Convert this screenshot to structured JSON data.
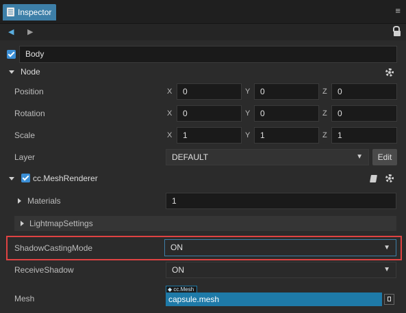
{
  "tab": {
    "title": "Inspector"
  },
  "node_name": "Body",
  "sections": {
    "node": "Node",
    "mesh_renderer": "cc.MeshRenderer"
  },
  "transform": {
    "position": {
      "label": "Position",
      "x": "0",
      "y": "0",
      "z": "0"
    },
    "rotation": {
      "label": "Rotation",
      "x": "0",
      "y": "0",
      "z": "0"
    },
    "scale": {
      "label": "Scale",
      "x": "1",
      "y": "1",
      "z": "1"
    }
  },
  "axes": {
    "x": "X",
    "y": "Y",
    "z": "Z"
  },
  "layer": {
    "label": "Layer",
    "value": "DEFAULT",
    "edit_label": "Edit"
  },
  "mesh_renderer": {
    "materials_label": "Materials",
    "materials_value": "1",
    "lightmap_label": "LightmapSettings",
    "shadow_casting_label": "ShadowCastingMode",
    "shadow_casting_value": "ON",
    "receive_shadow_label": "ReceiveShadow",
    "receive_shadow_value": "ON",
    "mesh_label": "Mesh",
    "mesh_type": "◆ cc.Mesh",
    "mesh_value": "capsule.mesh"
  },
  "colors": {
    "accent": "#3d7fa8",
    "highlight": "#e04343",
    "asset": "#1e7aa8"
  }
}
